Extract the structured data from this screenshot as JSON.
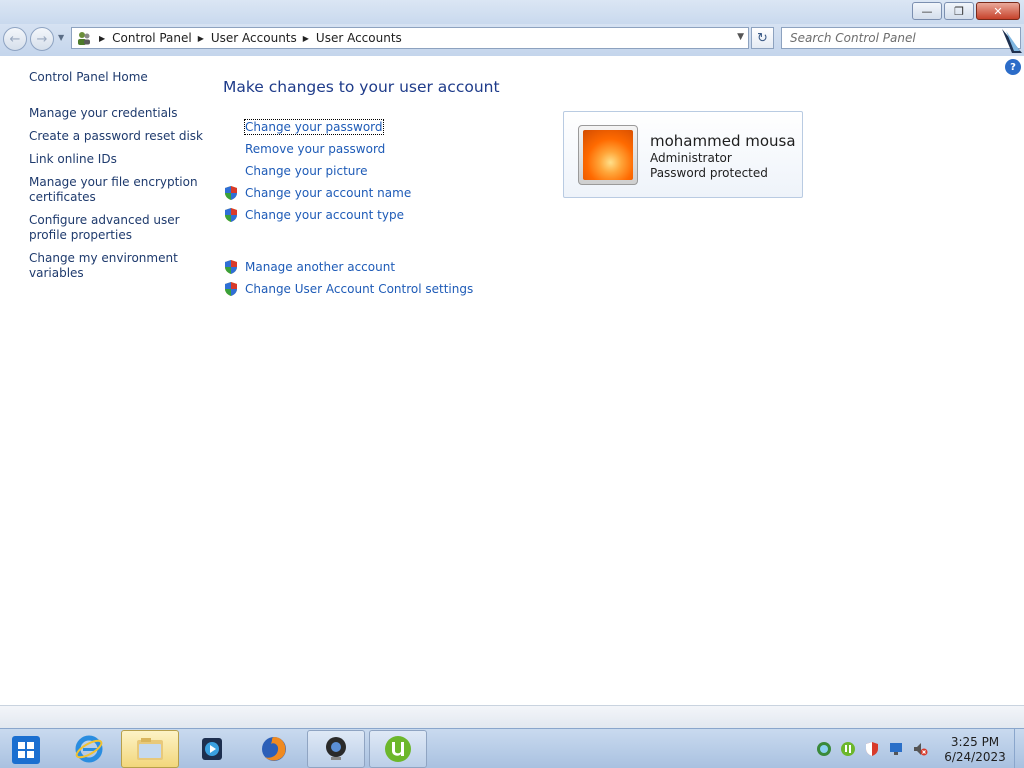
{
  "window": {
    "minimize_label": "—",
    "restore_label": "❐",
    "close_label": "✕"
  },
  "address": {
    "crumbs": [
      "Control Panel",
      "User Accounts",
      "User Accounts"
    ]
  },
  "search": {
    "placeholder": "Search Control Panel"
  },
  "left_pane": {
    "home": "Control Panel Home",
    "items": [
      "Manage your credentials",
      "Create a password reset disk",
      "Link online IDs",
      "Manage your file encryption certificates",
      "Configure advanced user profile properties",
      "Change my environment variables"
    ]
  },
  "main": {
    "title": "Make changes to your user account",
    "tasks": [
      {
        "label": "Change your password",
        "shield": false
      },
      {
        "label": "Remove your password",
        "shield": false
      },
      {
        "label": "Change your picture",
        "shield": false
      },
      {
        "label": "Change your account name",
        "shield": true
      },
      {
        "label": "Change your account type",
        "shield": true
      }
    ],
    "other_tasks": [
      {
        "label": "Manage another account",
        "shield": true
      },
      {
        "label": "Change User Account Control settings",
        "shield": true
      }
    ]
  },
  "user": {
    "name": "mohammed mousa",
    "role": "Administrator",
    "status": "Password protected"
  },
  "taskbar": {
    "apps": [
      "internet-explorer-icon",
      "windows-explorer-icon",
      "media-player-icon",
      "firefox-icon",
      "webcam-icon",
      "utorrent-icon"
    ],
    "clock_time": "3:25 PM",
    "clock_date": "6/24/2023"
  },
  "colors": {
    "link": "#1e5bb7",
    "title": "#1e3b8a",
    "left_link": "#1e3a6d"
  }
}
